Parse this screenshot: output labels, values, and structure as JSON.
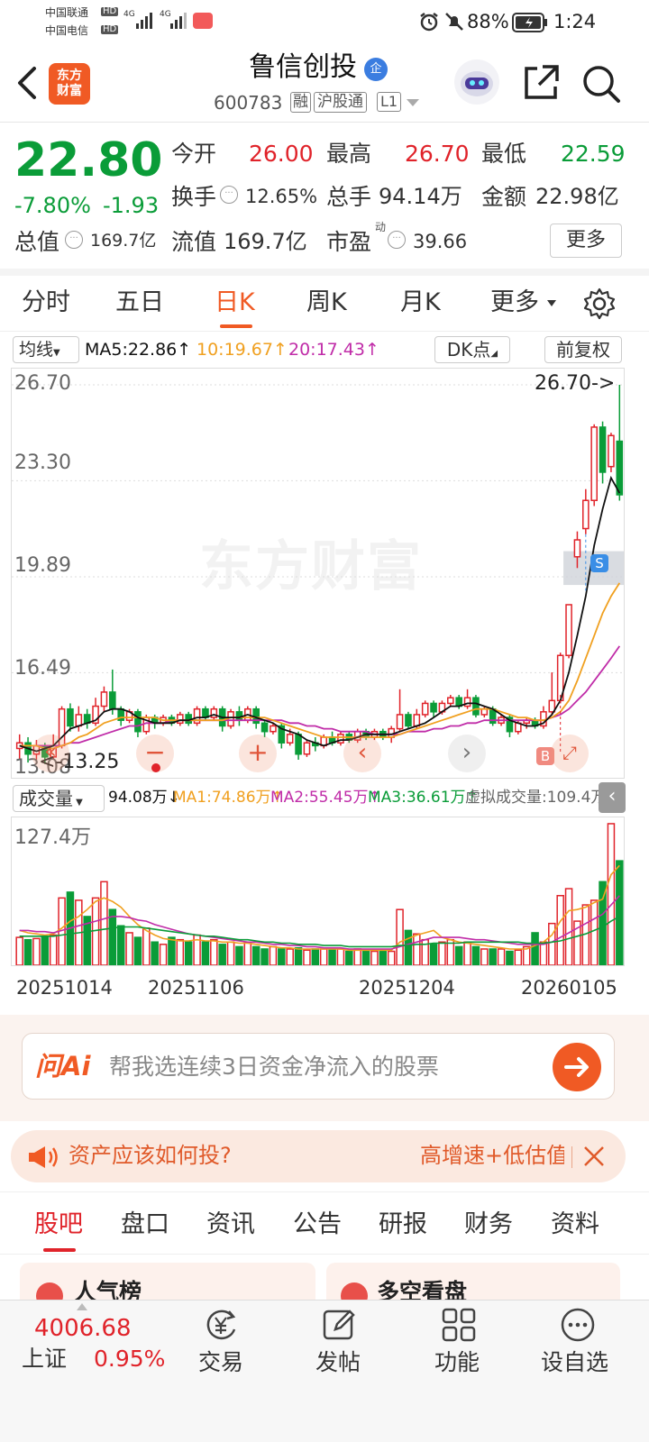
{
  "status_bar": {
    "carrier1": "中国联通",
    "carrier2": "中国电信",
    "hd": "HD",
    "net": "4G",
    "battery": "88%",
    "time": "1:24"
  },
  "header": {
    "logo_line1": "东方",
    "logo_line2": "财富",
    "name": "鲁信创投",
    "badge": "企",
    "code": "600783",
    "tag_rong": "融",
    "tag_hgt": "沪股通",
    "tag_l1": "L1"
  },
  "quote": {
    "price": "22.80",
    "pct": "-7.80%",
    "chg": "-1.93",
    "open_label": "今开",
    "open": "26.00",
    "high_label": "最高",
    "high": "26.70",
    "low_label": "最低",
    "low": "22.59",
    "turnover_label": "换手",
    "turnover": "12.65%",
    "vol_label": "总手",
    "vol": "94.14万",
    "amount_label": "金额",
    "amount": "22.98亿",
    "mcap_label": "总值",
    "mcap": "169.7亿",
    "float_label": "流值",
    "float": "169.7亿",
    "pe_label": "市盈",
    "pe_sup": "动",
    "pe": "39.66",
    "more": "更多"
  },
  "tabs": [
    "分时",
    "五日",
    "日K",
    "周K",
    "月K",
    "更多"
  ],
  "active_tab": 2,
  "ma_bar": {
    "selector": "均线",
    "ma5": "MA5:22.86↑",
    "ma10": "10:19.67↑",
    "ma20": "20:17.43↑",
    "dk": "DK点",
    "fq": "前复权"
  },
  "chart_data": {
    "type": "candlestick",
    "y_ticks": [
      "26.70",
      "23.30",
      "19.89",
      "16.49",
      "13.08"
    ],
    "ylim": [
      13.08,
      26.7
    ],
    "high_marker": "26.70->",
    "low_marker": "13.25",
    "watermark": "东方财富",
    "markers": {
      "buy": "B",
      "sell": "S"
    },
    "x_labels": [
      "20251014",
      "20251106",
      "20251204",
      "20260105"
    ],
    "vol_max": "127.4万",
    "candles": [
      [
        13.8,
        14.0,
        13.4,
        14.3
      ],
      [
        14.0,
        13.6,
        13.3,
        14.2
      ],
      [
        13.6,
        13.9,
        13.4,
        14.1
      ],
      [
        13.9,
        13.5,
        13.25,
        14.0
      ],
      [
        13.5,
        13.9,
        13.4,
        14.3
      ],
      [
        13.9,
        15.2,
        13.8,
        15.3
      ],
      [
        15.2,
        14.6,
        14.4,
        15.4
      ],
      [
        14.6,
        15.0,
        14.4,
        15.3
      ],
      [
        15.0,
        14.7,
        14.5,
        15.2
      ],
      [
        14.7,
        15.3,
        14.6,
        15.6
      ],
      [
        15.3,
        15.8,
        15.1,
        16.0
      ],
      [
        15.8,
        15.2,
        15.0,
        16.6
      ],
      [
        15.2,
        14.8,
        14.6,
        15.3
      ],
      [
        14.8,
        15.1,
        14.7,
        15.2
      ],
      [
        15.1,
        14.4,
        14.2,
        15.2
      ],
      [
        14.4,
        14.9,
        14.3,
        15.0
      ],
      [
        14.9,
        14.7,
        14.5,
        15.0
      ],
      [
        14.7,
        14.9,
        14.6,
        15.0
      ],
      [
        14.9,
        14.7,
        14.6,
        15.0
      ],
      [
        14.7,
        15.0,
        14.6,
        15.1
      ],
      [
        15.0,
        14.7,
        14.6,
        15.1
      ],
      [
        14.7,
        15.2,
        14.6,
        15.3
      ],
      [
        15.2,
        14.9,
        14.8,
        15.3
      ],
      [
        14.9,
        15.2,
        14.8,
        15.3
      ],
      [
        15.2,
        14.6,
        14.4,
        15.3
      ],
      [
        14.6,
        15.1,
        14.5,
        15.2
      ],
      [
        15.1,
        14.8,
        14.6,
        15.3
      ],
      [
        14.8,
        15.2,
        14.7,
        15.3
      ],
      [
        15.2,
        14.7,
        14.5,
        15.3
      ],
      [
        14.7,
        14.4,
        14.2,
        14.8
      ],
      [
        14.4,
        14.6,
        14.3,
        14.7
      ],
      [
        14.6,
        14.0,
        13.8,
        14.7
      ],
      [
        14.0,
        14.3,
        13.9,
        14.5
      ],
      [
        14.3,
        13.6,
        13.4,
        14.4
      ],
      [
        13.6,
        14.0,
        13.5,
        14.1
      ],
      [
        14.0,
        13.9,
        13.7,
        14.2
      ],
      [
        13.9,
        14.2,
        13.8,
        14.3
      ],
      [
        14.2,
        14.0,
        13.9,
        14.4
      ],
      [
        14.0,
        14.3,
        13.9,
        14.4
      ],
      [
        14.3,
        14.1,
        14.0,
        14.4
      ],
      [
        14.1,
        14.4,
        14.0,
        14.5
      ],
      [
        14.4,
        14.2,
        14.1,
        14.5
      ],
      [
        14.2,
        14.4,
        14.1,
        14.5
      ],
      [
        14.4,
        14.2,
        14.1,
        14.5
      ],
      [
        14.2,
        14.5,
        14.0,
        14.6
      ],
      [
        14.5,
        15.0,
        14.4,
        15.9
      ],
      [
        15.0,
        14.6,
        14.5,
        15.1
      ],
      [
        14.6,
        15.0,
        14.5,
        15.2
      ],
      [
        15.0,
        15.4,
        14.9,
        15.5
      ],
      [
        15.4,
        15.1,
        14.9,
        15.5
      ],
      [
        15.1,
        15.4,
        15.0,
        15.5
      ],
      [
        15.4,
        15.6,
        15.3,
        15.7
      ],
      [
        15.6,
        15.3,
        15.2,
        15.7
      ],
      [
        15.3,
        15.6,
        15.2,
        15.9
      ],
      [
        15.6,
        15.0,
        14.9,
        15.7
      ],
      [
        15.0,
        15.2,
        14.9,
        15.3
      ],
      [
        15.2,
        14.7,
        14.6,
        15.3
      ],
      [
        14.7,
        14.9,
        14.6,
        15.0
      ],
      [
        14.9,
        14.4,
        14.2,
        15.0
      ],
      [
        14.4,
        14.7,
        14.3,
        14.8
      ],
      [
        14.7,
        14.8,
        14.5,
        14.9
      ],
      [
        14.8,
        14.6,
        14.5,
        14.9
      ],
      [
        14.6,
        15.1,
        14.5,
        15.3
      ],
      [
        15.1,
        15.5,
        15.0,
        16.5
      ],
      [
        15.5,
        17.1,
        15.4,
        17.2
      ],
      [
        17.1,
        18.9,
        17.0,
        18.9
      ],
      [
        20.6,
        21.2,
        20.2,
        21.5
      ],
      [
        21.6,
        22.6,
        21.4,
        23.0
      ],
      [
        22.6,
        25.2,
        22.4,
        25.3
      ],
      [
        25.2,
        23.6,
        23.2,
        25.4
      ],
      [
        23.8,
        24.9,
        23.6,
        25.0
      ],
      [
        24.7,
        22.8,
        22.59,
        26.7
      ]
    ],
    "ma5": [
      13.9,
      13.8,
      13.7,
      13.8,
      13.9,
      14.2,
      14.5,
      14.6,
      14.7,
      14.8,
      15.1,
      15.2,
      15.2,
      15.1,
      14.9,
      14.8,
      14.7,
      14.7,
      14.7,
      14.8,
      14.8,
      14.9,
      14.9,
      15.0,
      14.9,
      14.9,
      14.9,
      15.0,
      14.9,
      14.8,
      14.7,
      14.5,
      14.4,
      14.3,
      14.1,
      14.0,
      13.9,
      14.0,
      14.1,
      14.1,
      14.2,
      14.3,
      14.3,
      14.3,
      14.3,
      14.4,
      14.5,
      14.6,
      14.7,
      14.9,
      15.1,
      15.3,
      15.3,
      15.4,
      15.4,
      15.3,
      15.2,
      15.0,
      14.8,
      14.7,
      14.6,
      14.6,
      14.7,
      15.0,
      15.5,
      16.5,
      17.8,
      19.2,
      21.0,
      22.3,
      23.4,
      22.86
    ],
    "ma10": [
      13.9,
      13.9,
      13.9,
      13.8,
      13.8,
      13.9,
      14.0,
      14.2,
      14.3,
      14.5,
      14.7,
      14.8,
      14.9,
      14.9,
      14.9,
      14.9,
      14.9,
      14.8,
      14.8,
      14.8,
      14.8,
      14.8,
      14.8,
      14.8,
      14.8,
      14.9,
      14.9,
      14.9,
      14.9,
      14.9,
      14.8,
      14.7,
      14.6,
      14.5,
      14.4,
      14.3,
      14.2,
      14.2,
      14.2,
      14.2,
      14.2,
      14.2,
      14.2,
      14.2,
      14.2,
      14.3,
      14.4,
      14.5,
      14.6,
      14.7,
      14.8,
      14.9,
      15.0,
      15.1,
      15.2,
      15.2,
      15.2,
      15.1,
      15.0,
      14.9,
      14.9,
      14.8,
      14.8,
      14.9,
      15.1,
      15.5,
      16.2,
      17.0,
      17.8,
      18.6,
      19.2,
      19.67
    ],
    "ma20": [
      13.9,
      13.9,
      13.9,
      13.9,
      13.9,
      13.9,
      14.0,
      14.0,
      14.1,
      14.2,
      14.3,
      14.4,
      14.5,
      14.6,
      14.6,
      14.7,
      14.7,
      14.7,
      14.8,
      14.8,
      14.8,
      14.8,
      14.8,
      14.8,
      14.8,
      14.8,
      14.8,
      14.8,
      14.8,
      14.8,
      14.8,
      14.8,
      14.7,
      14.7,
      14.6,
      14.6,
      14.5,
      14.5,
      14.4,
      14.4,
      14.4,
      14.4,
      14.3,
      14.3,
      14.3,
      14.3,
      14.4,
      14.4,
      14.4,
      14.5,
      14.5,
      14.6,
      14.6,
      14.7,
      14.7,
      14.8,
      14.8,
      14.8,
      14.8,
      14.8,
      14.8,
      14.8,
      14.8,
      14.9,
      15.0,
      15.2,
      15.5,
      15.8,
      16.2,
      16.6,
      17.0,
      17.43
    ],
    "volumes": [
      24,
      22,
      23,
      24,
      26,
      58,
      63,
      56,
      42,
      58,
      72,
      48,
      34,
      28,
      24,
      32,
      20,
      18,
      24,
      22,
      20,
      26,
      20,
      22,
      18,
      20,
      16,
      20,
      16,
      14,
      16,
      14,
      14,
      15,
      13,
      14,
      14,
      13,
      14,
      12,
      14,
      12,
      12,
      13,
      12,
      48,
      30,
      27,
      22,
      18,
      20,
      22,
      16,
      20,
      16,
      14,
      14,
      14,
      12,
      13,
      16,
      28,
      20,
      36,
      60,
      66,
      38,
      52,
      56,
      72,
      122,
      90
    ],
    "vol_ma1": [
      30,
      28,
      27,
      26,
      27,
      32,
      38,
      42,
      48,
      55,
      58,
      55,
      50,
      42,
      35,
      30,
      26,
      23,
      22,
      21,
      21,
      22,
      21,
      21,
      20,
      20,
      19,
      19,
      18,
      17,
      16,
      15,
      15,
      14,
      14,
      14,
      14,
      14,
      14,
      13,
      13,
      13,
      13,
      13,
      13,
      20,
      23,
      26,
      28,
      30,
      24,
      22,
      20,
      19,
      18,
      17,
      16,
      15,
      14,
      14,
      14,
      17,
      20,
      26,
      38,
      47,
      48,
      50,
      54,
      57,
      78,
      86
    ],
    "vol_ma2": [
      30,
      30,
      29,
      29,
      28,
      30,
      32,
      34,
      36,
      38,
      40,
      42,
      42,
      41,
      39,
      38,
      35,
      33,
      31,
      29,
      27,
      26,
      25,
      24,
      23,
      22,
      21,
      20,
      20,
      19,
      18,
      18,
      17,
      17,
      16,
      16,
      15,
      15,
      15,
      14,
      14,
      14,
      14,
      14,
      14,
      16,
      18,
      20,
      22,
      24,
      24,
      24,
      24,
      23,
      22,
      22,
      21,
      20,
      19,
      18,
      18,
      18,
      18,
      20,
      24,
      28,
      32,
      36,
      40,
      44,
      52,
      60
    ],
    "vol_ma3": [
      25,
      25,
      25,
      25,
      25,
      26,
      27,
      28,
      29,
      30,
      31,
      32,
      33,
      33,
      33,
      32,
      31,
      30,
      29,
      28,
      27,
      26,
      25,
      25,
      24,
      23,
      22,
      22,
      21,
      20,
      20,
      19,
      19,
      18,
      18,
      18,
      17,
      17,
      17,
      16,
      16,
      16,
      16,
      16,
      16,
      17,
      17,
      18,
      18,
      19,
      19,
      19,
      19,
      20,
      20,
      20,
      20,
      20,
      20,
      20,
      19,
      19,
      19,
      20,
      21,
      23,
      25,
      27,
      30,
      33,
      38,
      42
    ]
  },
  "vol_bar": {
    "selector": "成交量",
    "vol": "94.08万↓",
    "ma1": "MA1:74.86万↑",
    "ma2": "MA2:55.45万↑",
    "ma3": "MA3:36.61万↑",
    "virtual": "虚拟成交量:109.4万"
  },
  "ai": {
    "brand": "问Ai",
    "placeholder": "帮我选连续3日资金净流入的股票"
  },
  "banner": {
    "text": "资产应该如何投?",
    "right": "高增速+低估值"
  },
  "bottom_tabs": [
    "股吧",
    "盘口",
    "资讯",
    "公告",
    "研报",
    "财务",
    "资料"
  ],
  "cards": {
    "left": "人气榜",
    "right": "多空看盘"
  },
  "nav": {
    "index_value": "4006.68",
    "index_name": "上证",
    "index_pct": "0.95%",
    "trade": "交易",
    "post": "发帖",
    "func": "功能",
    "watch": "设自选"
  },
  "colors": {
    "up": "#e0232a",
    "down": "#0a9c38",
    "accent": "#f05a24",
    "ma5": "#111111",
    "ma10": "#f0a020",
    "ma20": "#c02ca8"
  }
}
